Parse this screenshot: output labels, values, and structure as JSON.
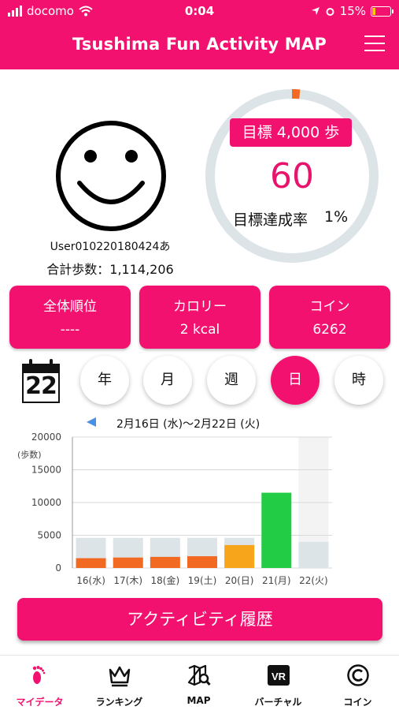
{
  "status_bar": {
    "carrier": "docomo",
    "time": "0:04",
    "battery": "15%"
  },
  "header": {
    "title": "Tsushima Fun Activity MAP",
    "menu_icon": "hamburger-menu-icon"
  },
  "profile": {
    "avatar_icon": "smiley-face-icon",
    "user_name": "User010220180424あ",
    "total_steps": "合計歩数：1,114,206"
  },
  "goal": {
    "target_label": "目標 4,000 歩",
    "steps_today": "60",
    "rate_label": "目標達成率",
    "rate_value": "1%",
    "rate_fraction": 0.015,
    "ring_color": "#dce4e8",
    "progress_color": "#f26a21"
  },
  "stats": [
    {
      "label": "全体順位",
      "value": "----"
    },
    {
      "label": "カロリー",
      "value": "2 kcal"
    },
    {
      "label": "コイン",
      "value": "6262"
    }
  ],
  "calendar": {
    "icon": "calendar-icon",
    "day": "22"
  },
  "periods": [
    {
      "label": "年",
      "active": false
    },
    {
      "label": "月",
      "active": false
    },
    {
      "label": "週",
      "active": false
    },
    {
      "label": "日",
      "active": true
    },
    {
      "label": "時",
      "active": false
    }
  ],
  "chart_data": {
    "type": "bar",
    "title": "2月16日 (水)〜2月22日 (火)",
    "prev_icon": "triangle-left-icon",
    "ylabel": "(歩数)",
    "ylim": [
      0,
      20000
    ],
    "yticks": [
      "0",
      "5000",
      "10000",
      "15000",
      "20000"
    ],
    "categories": [
      "16(水)",
      "17(木)",
      "18(金)",
      "19(土)",
      "20(日)",
      "21(月)",
      "22(火)"
    ],
    "background_values": [
      4600,
      4600,
      4600,
      4600,
      4600,
      4600,
      4000
    ],
    "values": [
      1500,
      1600,
      1700,
      1800,
      3500,
      11500,
      0
    ],
    "bar_colors": [
      "#f26a21",
      "#f26a21",
      "#f26a21",
      "#f26a21",
      "#f7a61c",
      "#22cc44",
      "#f26a21"
    ],
    "highlight_column": 6
  },
  "actions": {
    "history_label": "アクティビティ履歴"
  },
  "nav": [
    {
      "label": "マイデータ",
      "icon": "footprints-icon",
      "active": true
    },
    {
      "label": "ランキング",
      "icon": "crown-icon",
      "active": false
    },
    {
      "label": "MAP",
      "icon": "map-search-icon",
      "active": false
    },
    {
      "label": "バーチャル",
      "icon": "vr-icon",
      "active": false
    },
    {
      "label": "コイン",
      "icon": "copyright-coin-icon",
      "active": false
    }
  ]
}
